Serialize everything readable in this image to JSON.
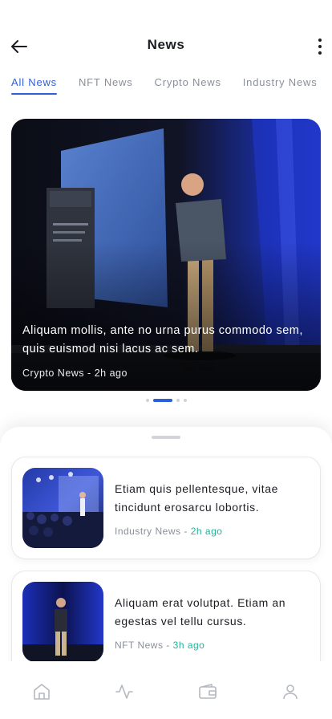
{
  "header": {
    "title": "News",
    "back_icon": "arrow-left-icon",
    "menu_icon": "more-vertical-icon"
  },
  "tabs": [
    {
      "label": "All News",
      "active": true
    },
    {
      "label": "NFT News",
      "active": false
    },
    {
      "label": "Crypto News",
      "active": false
    },
    {
      "label": "Industry News",
      "active": false
    }
  ],
  "featured": {
    "title": "Aliquam mollis, ante no urna purus commodo sem, quis euismod nisi lacus ac sem.",
    "category": "Crypto News",
    "separator": "-",
    "time": "2h ago",
    "carousel_count": 4,
    "carousel_active": 1
  },
  "news_list": [
    {
      "title": "Etiam quis pellentesque, vitae tincidunt erosarcu lobortis.",
      "category": "Industry News",
      "separator": "-",
      "time": "2h ago"
    },
    {
      "title": "Aliquam erat volutpat. Etiam an egestas vel tellu cursus.",
      "category": "NFT News",
      "separator": "-",
      "time": "3h ago"
    }
  ],
  "bottom_nav": [
    {
      "icon": "home-icon",
      "active": false
    },
    {
      "icon": "activity-icon",
      "active": false
    },
    {
      "icon": "wallet-icon",
      "active": false
    },
    {
      "icon": "user-icon",
      "active": false
    }
  ],
  "colors": {
    "accent": "#2f5fd8",
    "time_green": "#24b39a",
    "muted": "#8a8f99",
    "text": "#1b1d23"
  }
}
